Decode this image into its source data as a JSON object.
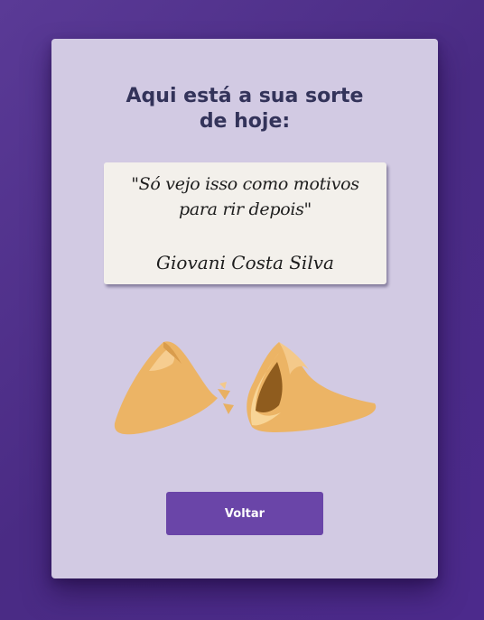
{
  "card": {
    "title_line1": "Aqui está a sua sorte",
    "title_line2": "de hoje:"
  },
  "fortune": {
    "quote": "\"Só vejo isso como motivos para rir depois\"",
    "author": "Giovani Costa Silva"
  },
  "illustration": {
    "icon": "fortune-cookie-icon"
  },
  "actions": {
    "back_label": "Voltar"
  },
  "colors": {
    "background": "#4c2e8c",
    "card": "#d2cae3",
    "title": "#33335a",
    "paper": "#f3f0eb",
    "button": "#6a45a8",
    "cookie": "#ecb465"
  }
}
